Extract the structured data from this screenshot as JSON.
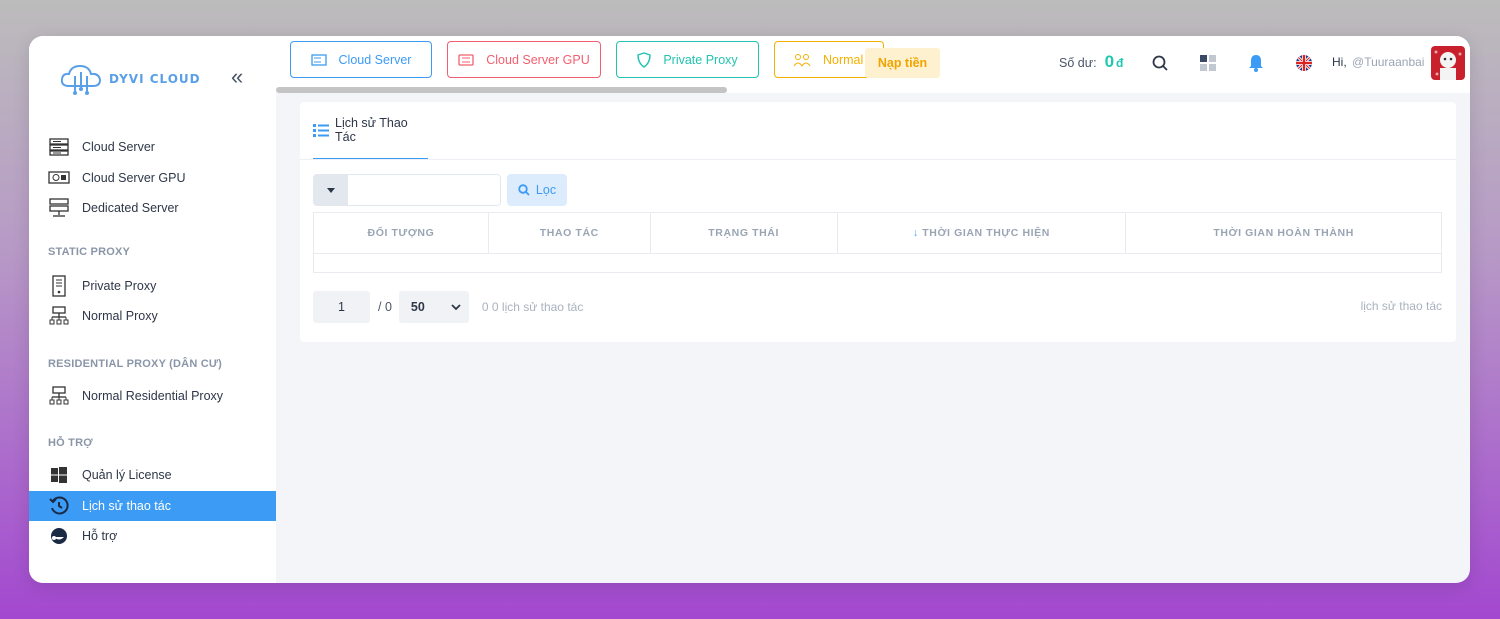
{
  "app": {
    "logo_text": "DYVI CLOUD"
  },
  "sidebar": {
    "top_items": [
      {
        "label": "Cloud Server",
        "icon": "server-rack-icon"
      },
      {
        "label": "Cloud Server GPU",
        "icon": "gpu-card-icon"
      },
      {
        "label": "Dedicated Server",
        "icon": "dedicated-server-icon"
      }
    ],
    "static_proxy": {
      "title": "STATIC PROXY",
      "items": [
        {
          "label": "Private Proxy",
          "icon": "tower-icon"
        },
        {
          "label": "Normal Proxy",
          "icon": "network-icon"
        }
      ]
    },
    "residential_proxy": {
      "title": "RESIDENTIAL PROXY (DÂN CƯ)",
      "items": [
        {
          "label": "Normal Residential Proxy",
          "icon": "network-icon"
        }
      ]
    },
    "support": {
      "title": "HỖ TRỢ",
      "items": [
        {
          "label": "Quản lý License",
          "icon": "windows-icon"
        },
        {
          "label": "Lịch sử thao tác",
          "icon": "history-icon",
          "active": true
        },
        {
          "label": "Hỗ trợ",
          "icon": "headset-icon"
        }
      ]
    }
  },
  "topbar": {
    "tabs": [
      {
        "label": "Cloud Server",
        "color": "#3c9bf5"
      },
      {
        "label": "Cloud Server GPU",
        "color": "#f25f6e"
      },
      {
        "label": "Private Proxy",
        "color": "#22c3b0"
      },
      {
        "label": "Normal Pr",
        "color": "#f4b000"
      }
    ],
    "topup_label": "Nạp tiền",
    "balance_label": "Số dư:",
    "balance_value": "0",
    "currency": "đ",
    "greeting": "Hi,",
    "username": "@Tuuraanbai"
  },
  "content": {
    "tab_label": "Lịch sử Thao Tác",
    "filter_value": "",
    "filter_button": "Lọc",
    "columns": [
      "ĐỐI TƯỢNG",
      "THAO TÁC",
      "TRẠNG THÁI",
      "THỜI GIAN THỰC HIỆN",
      "THỜI GIAN HOÀN THÀNH"
    ],
    "sort_indicator": "↓",
    "rows": [],
    "pagination": {
      "page": "1",
      "total_pages": "/ 0",
      "page_size": "50",
      "count_text": "0 0 lịch sử thao tác",
      "right_text": "lịch sử thao tác"
    }
  },
  "colors": {
    "accent": "#3c9bf5",
    "balance": "#1fc8b0",
    "topup": "#f0a400"
  }
}
